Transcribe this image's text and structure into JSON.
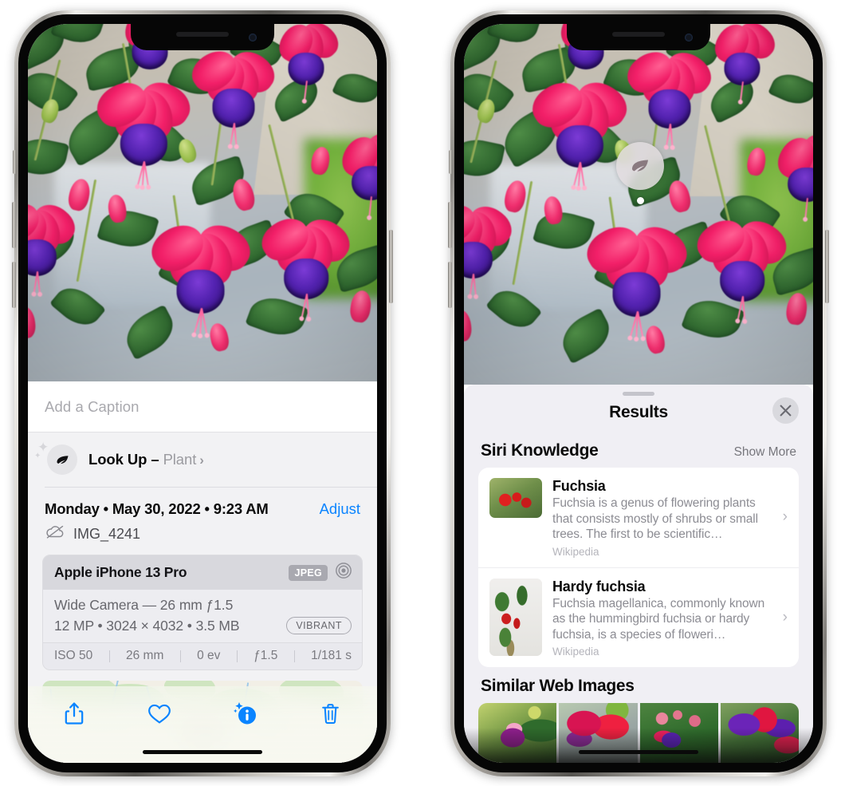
{
  "left_phone": {
    "name": "photo-detail-screen",
    "caption_field": {
      "placeholder": "Add a Caption",
      "value": ""
    },
    "lookup_row": {
      "icon": "leaf-icon",
      "sparkle_icon": "sparkles-icon",
      "label": "Look Up – ",
      "subject": "Plant",
      "chevron": "›"
    },
    "date_row": {
      "date": "Monday • May 30, 2022 • 9:23 AM",
      "adjust_label": "Adjust"
    },
    "file_row": {
      "icon": "cloud-slash-icon",
      "filename": "IMG_4241"
    },
    "metadata": {
      "device": "Apple iPhone 13 Pro",
      "format_badge": "JPEG",
      "lens_icon": "aperture-icon",
      "lens_line": "Wide Camera — 26 mm ƒ1.5",
      "size_line": "12 MP • 3024 × 4032 • 3.5 MB",
      "style_badge": "VIBRANT",
      "exif": [
        "ISO 50",
        "26 mm",
        "0 ev",
        "ƒ1.5",
        "1/181 s"
      ]
    },
    "map": {
      "name": "location-map",
      "pin": "photo-thumbnail-pin"
    },
    "toolbar": [
      {
        "name": "share-button",
        "icon": "share-icon"
      },
      {
        "name": "favorite-button",
        "icon": "heart-icon"
      },
      {
        "name": "info-button",
        "icon": "info-sparkle-icon"
      },
      {
        "name": "delete-button",
        "icon": "trash-icon"
      }
    ],
    "accent_color": "#0a84ff"
  },
  "right_phone": {
    "name": "visual-lookup-results-screen",
    "photo_badge": {
      "name": "visual-lookup-leaf-badge",
      "icon": "leaf-icon"
    },
    "results_sheet": {
      "grabber": "drag-handle",
      "title": "Results",
      "close_label": "✕"
    },
    "siri_knowledge": {
      "section_title": "Siri Knowledge",
      "action_label": "Show More",
      "items": [
        {
          "title": "Fuchsia",
          "description": "Fuchsia is a genus of flowering plants that consists mostly of shrubs or small trees. The first to be scientific…",
          "source": "Wikipedia",
          "chevron": "›"
        },
        {
          "title": "Hardy fuchsia",
          "description": "Fuchsia magellanica, commonly known as the hummingbird fuchsia or hardy fuchsia, is a species of floweri…",
          "source": "Wikipedia",
          "chevron": "›"
        }
      ]
    },
    "similar_web_images": {
      "section_title": "Similar Web Images",
      "thumbnails": [
        "fuchsia-web-image-1",
        "fuchsia-web-image-2",
        "fuchsia-web-image-3",
        "fuchsia-web-image-4"
      ]
    }
  },
  "colors": {
    "accent_blue": "#0a84ff",
    "sheet_bg": "#f2f2f4",
    "results_bg": "#f0eff4",
    "card_bg": "#ffffff",
    "secondary_text": "#8c8c93"
  }
}
